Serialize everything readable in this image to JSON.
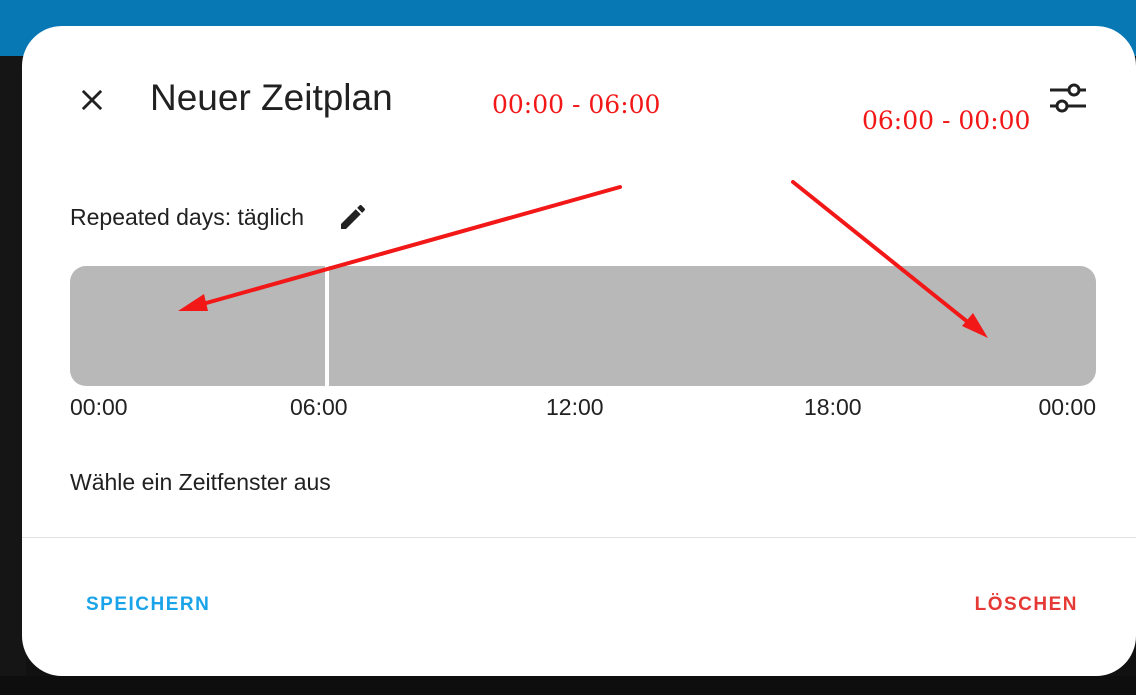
{
  "dialog": {
    "title": "Neuer Zeitplan",
    "close_icon": "close-icon",
    "settings_icon": "tune-icon",
    "repeated_days": "Repeated days: täglich",
    "edit_icon": "pencil-icon",
    "hint": "Wähle ein Zeitfenster aus",
    "save_label": "SPEICHERN",
    "delete_label": "LÖSCHEN"
  },
  "timeline": {
    "ticks": [
      "00:00",
      "06:00",
      "12:00",
      "18:00",
      "00:00"
    ],
    "segment_color": "#b8b8b8",
    "segments": [
      {
        "start": "00:00",
        "end": "06:00"
      },
      {
        "start": "06:00",
        "end": "00:00"
      }
    ]
  },
  "annotations": {
    "left_label": "00:00 - 06:00",
    "right_label": "06:00 - 00:00",
    "color": "#f21818"
  },
  "colors": {
    "header_bar": "#0878b5",
    "save": "#1aa3e8",
    "delete": "#e53935"
  }
}
